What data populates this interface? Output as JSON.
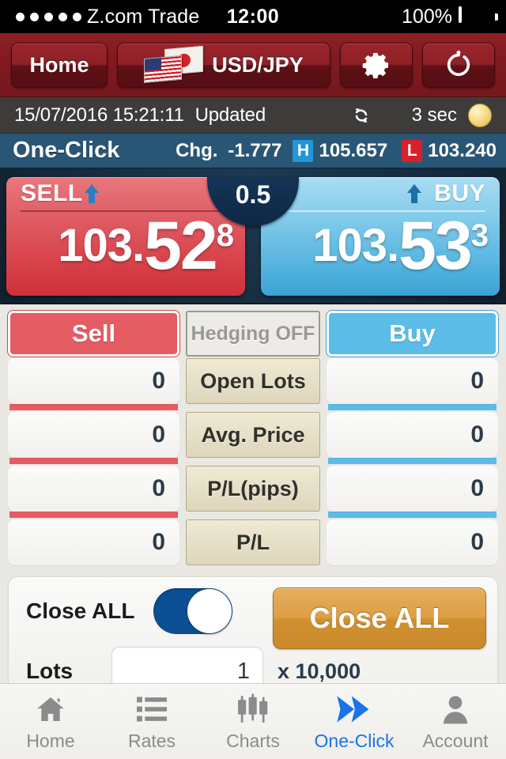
{
  "status_bar": {
    "carrier": "Z.com Trade",
    "time": "12:00",
    "battery_percent": "100%",
    "signal_dots": 5
  },
  "toolbar": {
    "home_label": "Home",
    "pair_label": "USD/JPY",
    "settings_icon": "gear-icon",
    "refresh_icon": "refresh-icon"
  },
  "update_bar": {
    "timestamp": "15/07/2016 15:21:11",
    "status": "Updated",
    "refresh_icon": "refresh-cycle-icon",
    "interval": "3 sec"
  },
  "quote_header": {
    "title": "One-Click",
    "chg_label": "Chg.",
    "chg_value": "-1.777",
    "high_badge": "H",
    "high_value": "105.657",
    "low_badge": "L",
    "low_value": "103.240",
    "high_color": "#2196d8",
    "low_color": "#d8202a"
  },
  "price_panel": {
    "sell": {
      "label": "SELL",
      "integer": "103.",
      "big": "52",
      "sup": "8",
      "color": "#d8434b"
    },
    "buy": {
      "label": "BUY",
      "integer": "103.",
      "big": "53",
      "sup": "3",
      "color": "#54b3df"
    },
    "spread": "0.5"
  },
  "positions": {
    "header": {
      "sell": "Sell",
      "hedging": "Hedging OFF",
      "buy": "Buy"
    },
    "rows": [
      {
        "label": "Open  Lots",
        "sell": "0",
        "buy": "0"
      },
      {
        "label": "Avg. Price",
        "sell": "0",
        "buy": "0"
      },
      {
        "label": "P/L(pips)",
        "sell": "0",
        "buy": "0"
      },
      {
        "label": "P/L",
        "sell": "0",
        "buy": "0"
      }
    ]
  },
  "close_all": {
    "toggle_label": "Close ALL",
    "toggle_state": "on",
    "button_label": "Close ALL",
    "lots_label": "Lots",
    "lots_value": "1",
    "multiplier": "x 10,000"
  },
  "tabbar": {
    "items": [
      {
        "label": "Home",
        "icon": "home-icon",
        "active": false
      },
      {
        "label": "Rates",
        "icon": "list-icon",
        "active": false
      },
      {
        "label": "Charts",
        "icon": "candlestick-icon",
        "active": false
      },
      {
        "label": "One-Click",
        "icon": "double-chevron-icon",
        "active": true
      },
      {
        "label": "Account",
        "icon": "person-icon",
        "active": false
      }
    ]
  }
}
